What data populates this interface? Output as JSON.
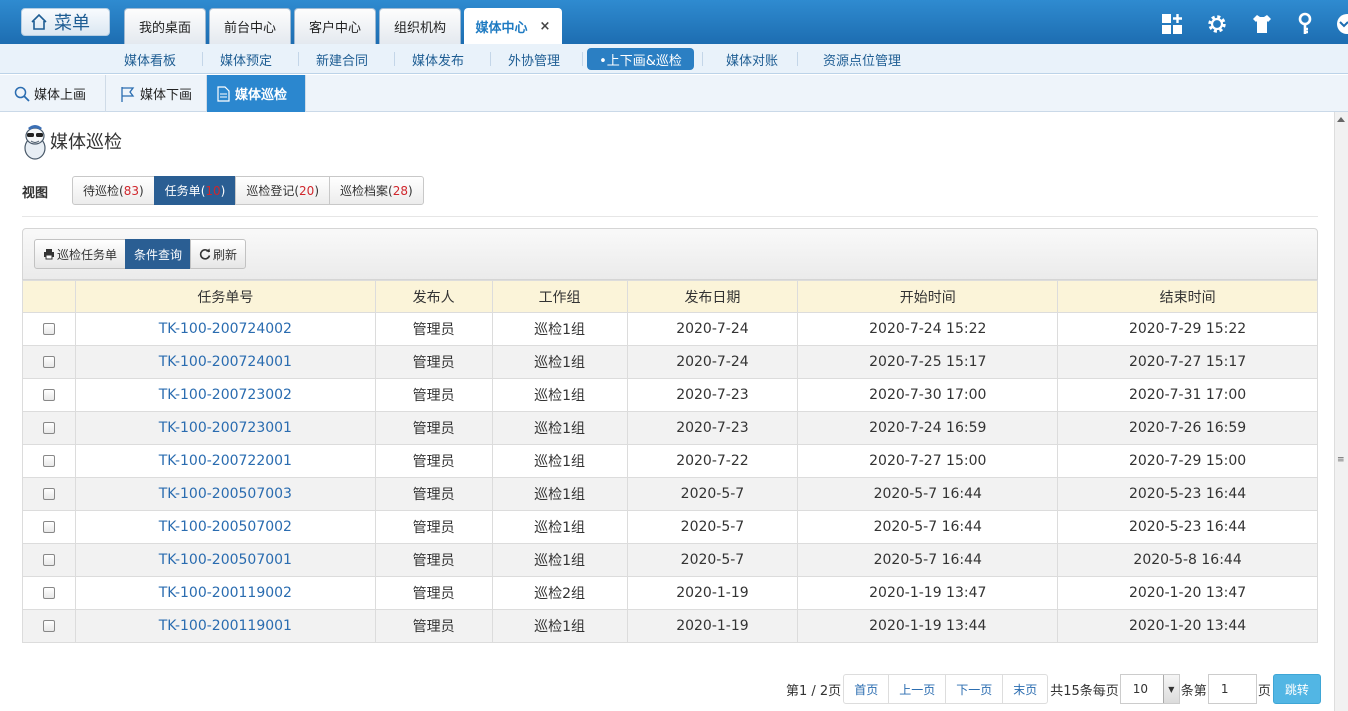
{
  "topbar": {
    "menu_label": "菜单",
    "tabs": [
      {
        "label": "我的桌面"
      },
      {
        "label": "前台中心"
      },
      {
        "label": "客户中心"
      },
      {
        "label": "组织机构"
      },
      {
        "label": "媒体中心",
        "close": "×"
      }
    ],
    "icons": [
      "add-widget-icon",
      "gear-icon",
      "shirt-icon",
      "key-icon",
      "collapse-icon"
    ]
  },
  "subnav": {
    "items": [
      {
        "label": "媒体看板"
      },
      {
        "label": "媒体预定"
      },
      {
        "label": "新建合同"
      },
      {
        "label": "媒体发布"
      },
      {
        "label": "外协管理"
      },
      {
        "label": "•上下画&巡检"
      },
      {
        "label": "媒体对账"
      },
      {
        "label": "资源点位管理"
      }
    ]
  },
  "thirdnav": {
    "items": [
      {
        "label": "媒体上画",
        "icon": "search-icon"
      },
      {
        "label": "媒体下画",
        "icon": "flag-icon"
      },
      {
        "label": "媒体巡检",
        "icon": "document-icon"
      }
    ]
  },
  "page": {
    "title": "媒体巡检",
    "view_label": "视图",
    "view_tabs": [
      {
        "label": "待巡检",
        "count": "83"
      },
      {
        "label": "任务单",
        "count": "10"
      },
      {
        "label": "巡检登记",
        "count": "20"
      },
      {
        "label": "巡检档案",
        "count": "28"
      }
    ]
  },
  "toolbar": {
    "print_label": "巡检任务单",
    "query_label": "条件查询",
    "refresh_label": "刷新"
  },
  "table": {
    "headers": [
      "任务单号",
      "发布人",
      "工作组",
      "发布日期",
      "开始时间",
      "结束时间"
    ],
    "rows": [
      [
        "TK-100-200724002",
        "管理员",
        "巡检1组",
        "2020-7-24",
        "2020-7-24 15:22",
        "2020-7-29 15:22"
      ],
      [
        "TK-100-200724001",
        "管理员",
        "巡检1组",
        "2020-7-24",
        "2020-7-25 15:17",
        "2020-7-27 15:17"
      ],
      [
        "TK-100-200723002",
        "管理员",
        "巡检1组",
        "2020-7-23",
        "2020-7-30 17:00",
        "2020-7-31 17:00"
      ],
      [
        "TK-100-200723001",
        "管理员",
        "巡检1组",
        "2020-7-23",
        "2020-7-24 16:59",
        "2020-7-26 16:59"
      ],
      [
        "TK-100-200722001",
        "管理员",
        "巡检1组",
        "2020-7-22",
        "2020-7-27 15:00",
        "2020-7-29 15:00"
      ],
      [
        "TK-100-200507003",
        "管理员",
        "巡检1组",
        "2020-5-7",
        "2020-5-7 16:44",
        "2020-5-23 16:44"
      ],
      [
        "TK-100-200507002",
        "管理员",
        "巡检1组",
        "2020-5-7",
        "2020-5-7 16:44",
        "2020-5-23 16:44"
      ],
      [
        "TK-100-200507001",
        "管理员",
        "巡检1组",
        "2020-5-7",
        "2020-5-7 16:44",
        "2020-5-8 16:44"
      ],
      [
        "TK-100-200119002",
        "管理员",
        "巡检2组",
        "2020-1-19",
        "2020-1-19 13:47",
        "2020-1-20 13:47"
      ],
      [
        "TK-100-200119001",
        "管理员",
        "巡检1组",
        "2020-1-19",
        "2020-1-19 13:44",
        "2020-1-20 13:44"
      ]
    ]
  },
  "pager": {
    "page_info": "第1 / 2页",
    "first": "首页",
    "prev": "上一页",
    "next": "下一页",
    "last": "末页",
    "total_text": "共15条每页",
    "page_size": "10",
    "per_suffix": "条第",
    "page_input": "1",
    "page_suffix": "页",
    "go": "跳转"
  },
  "colors": {
    "brand_blue": "#1f7bc2",
    "active_dark": "#2a5e93",
    "link": "#2a6cb0",
    "count_red": "#d0262c",
    "header_bg": "#fbf4d9"
  }
}
